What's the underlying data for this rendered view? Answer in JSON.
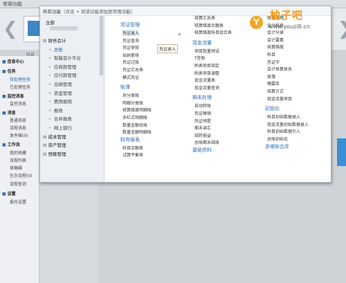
{
  "topbar": {
    "home": "常用功能"
  },
  "banner": {
    "kemu": "科目"
  },
  "sidebar": {
    "items": [
      {
        "label": "信息中心",
        "head": true
      },
      {
        "label": "任务",
        "head": true
      },
      {
        "label": "待处理任务",
        "head": false,
        "active": true
      },
      {
        "label": "已处理任务",
        "head": false
      },
      {
        "label": "监控消息",
        "head": true
      },
      {
        "label": "监控消息",
        "head": false
      },
      {
        "label": "消息",
        "head": true
      },
      {
        "label": "普通消息",
        "head": false
      },
      {
        "label": "流程消息",
        "head": false
      },
      {
        "label": "发件箱(0)",
        "head": false
      },
      {
        "label": "工作流",
        "head": true
      },
      {
        "label": "我的收藏",
        "head": false
      },
      {
        "label": "流程列表",
        "head": false
      },
      {
        "label": "草稿箱",
        "head": false
      },
      {
        "label": "在办流程(0)",
        "head": false
      },
      {
        "label": "流程查询",
        "head": false
      },
      {
        "label": "设置",
        "head": true
      },
      {
        "label": "委托设置",
        "head": false
      }
    ]
  },
  "popup": {
    "title": "所有功能",
    "hint": "（点击 + 将该功能添加到常用功能）",
    "all_label": "全部",
    "categories": [
      {
        "label": "财务会计",
        "type": "head"
      },
      {
        "label": "总账",
        "type": "child",
        "selected": true
      },
      {
        "label": "智能会计平台",
        "type": "child"
      },
      {
        "label": "应收款管理",
        "type": "child"
      },
      {
        "label": "应付款管理",
        "type": "child"
      },
      {
        "label": "出纳管理",
        "type": "child"
      },
      {
        "label": "资金管理",
        "type": "child"
      },
      {
        "label": "费用报销",
        "type": "child"
      },
      {
        "label": "报表",
        "type": "child"
      },
      {
        "label": "合并报表",
        "type": "child"
      },
      {
        "label": "网上银行",
        "type": "child"
      },
      {
        "label": "成本管理",
        "type": "head"
      },
      {
        "label": "资产管理",
        "type": "head"
      },
      {
        "label": "预算管理",
        "type": "head"
      }
    ],
    "columns": [
      [
        {
          "label": "凭证管理",
          "type": "sec"
        },
        {
          "label": "凭证录入",
          "type": "item",
          "hover": true
        },
        {
          "label": "凭证查询",
          "type": "item"
        },
        {
          "label": "凭证审核",
          "type": "item"
        },
        {
          "label": "出纳复核",
          "type": "item"
        },
        {
          "label": "凭证过账",
          "type": "item"
        },
        {
          "label": "凭证汇总表",
          "type": "item"
        },
        {
          "label": "模式凭证",
          "type": "item"
        },
        {
          "label": "",
          "type": "gap"
        },
        {
          "label": "账簿",
          "type": "sec"
        },
        {
          "label": "总分类账",
          "type": "item"
        },
        {
          "label": "明细分类账",
          "type": "item"
        },
        {
          "label": "核算维度明细账",
          "type": "item"
        },
        {
          "label": "多栏式明细账",
          "type": "item"
        },
        {
          "label": "数量金额总账",
          "type": "item"
        },
        {
          "label": "数量金额明细账",
          "type": "item"
        },
        {
          "label": "财务报表",
          "type": "sec"
        },
        {
          "label": "科目余额表",
          "type": "item"
        },
        {
          "label": "试算平衡表",
          "type": "item"
        }
      ],
      [
        {
          "label": "核算汇总表",
          "type": "item"
        },
        {
          "label": "核算维度余额表",
          "type": "item"
        },
        {
          "label": "核算维度科目组合表",
          "type": "item"
        },
        {
          "label": "",
          "type": "gap"
        },
        {
          "label": "现金流量",
          "type": "sec"
        },
        {
          "label": "项目批量预设",
          "type": "item"
        },
        {
          "label": "T型账",
          "type": "item"
        },
        {
          "label": "附表项目指定",
          "type": "item"
        },
        {
          "label": "附表项目调整",
          "type": "item"
        },
        {
          "label": "现金流量表",
          "type": "item"
        },
        {
          "label": "现金流量查询",
          "type": "item"
        },
        {
          "label": "",
          "type": "gap"
        },
        {
          "label": "期末处理",
          "type": "sec"
        },
        {
          "label": "自动转账",
          "type": "item"
        },
        {
          "label": "凭证摊销",
          "type": "item"
        },
        {
          "label": "凭证预提",
          "type": "item"
        },
        {
          "label": "期末调汇",
          "type": "item"
        },
        {
          "label": "结转损益",
          "type": "item"
        },
        {
          "label": "总账期末结账",
          "type": "item"
        },
        {
          "label": "基础资料",
          "type": "sec"
        }
      ],
      [
        {
          "label": "账簿管理",
          "type": "item"
        },
        {
          "label": "会计科目",
          "type": "item"
        },
        {
          "label": "会计分录",
          "type": "item"
        },
        {
          "label": "会计要素",
          "type": "item"
        },
        {
          "label": "核算维度",
          "type": "item"
        },
        {
          "label": "科目",
          "type": "item"
        },
        {
          "label": "凭证字",
          "type": "item"
        },
        {
          "label": "会计核算体系",
          "type": "item"
        },
        {
          "label": "账簿",
          "type": "item"
        },
        {
          "label": "摘要库",
          "type": "item"
        },
        {
          "label": "结算方式",
          "type": "item"
        },
        {
          "label": "现金流量项目",
          "type": "item"
        },
        {
          "label": "",
          "type": "gap"
        },
        {
          "label": "初始化",
          "type": "sec"
        },
        {
          "label": "科目初始数据录入",
          "type": "item"
        },
        {
          "label": "现金流量初始数据录入",
          "type": "item"
        },
        {
          "label": "科目初始数据引入",
          "type": "item"
        },
        {
          "label": "总账初始化",
          "type": "item"
        },
        {
          "label": "多维账合并",
          "type": "sec"
        }
      ]
    ],
    "plus": "+",
    "tooltip": "凭证录入"
  },
  "watermark": {
    "logo": "Y",
    "title": "柚子吧",
    "url": "www.youzi8.cn"
  }
}
